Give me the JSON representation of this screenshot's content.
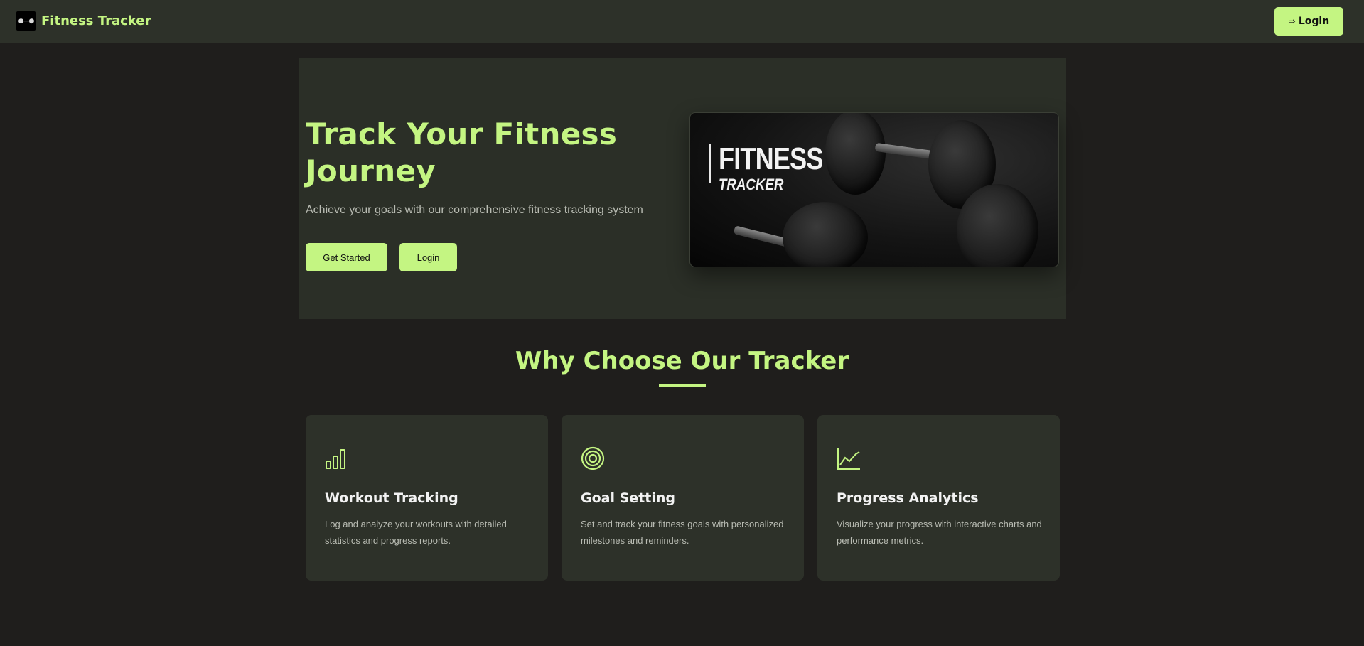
{
  "navbar": {
    "brand_name": "Fitness Tracker",
    "brand_icon": "dumbbell-icon",
    "login_label": "Login",
    "login_icon": "sign-in-icon"
  },
  "hero": {
    "title": "Track Your Fitness Journey",
    "subtitle": "Achieve your goals with our comprehensive fitness tracking system",
    "get_started_label": "Get Started",
    "login_label": "Login",
    "image": {
      "title": "FITNESS",
      "subtitle": "TRACKER"
    }
  },
  "features": {
    "title": "Why Choose Our Tracker",
    "cards": [
      {
        "icon": "bar-chart-icon",
        "title": "Workout Tracking",
        "description": "Log and analyze your workouts with detailed statistics and progress reports."
      },
      {
        "icon": "target-icon",
        "title": "Goal Setting",
        "description": "Set and track your fitness goals with personalized milestones and reminders."
      },
      {
        "icon": "line-chart-icon",
        "title": "Progress Analytics",
        "description": "Visualize your progress with interactive charts and performance metrics."
      }
    ]
  },
  "colors": {
    "accent": "#c4f582",
    "background": "#1f1e1c",
    "surface": "#2d3129"
  }
}
